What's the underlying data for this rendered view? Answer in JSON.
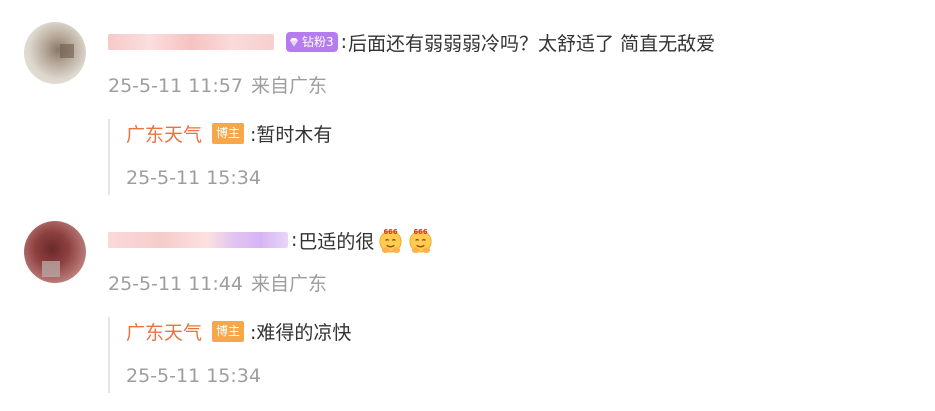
{
  "comments": [
    {
      "fan_badge": "钻粉3",
      "separator": ":",
      "text": "后面还有弱弱弱冷吗？太舒适了 简直无敌爱",
      "timestamp": "25-5-11 11:57",
      "source": "来自广东",
      "reply": {
        "author": "广东天气",
        "badge": "博主",
        "text": ":暂时木有",
        "timestamp": "25-5-11 15:34"
      }
    },
    {
      "separator": ":",
      "text": "巴适的很",
      "emojis": [
        "666-emoji-icon",
        "666-emoji-icon"
      ],
      "timestamp": "25-5-11 11:44",
      "source": "来自广东",
      "reply": {
        "author": "广东天气",
        "badge": "博主",
        "text": ":难得的凉快",
        "timestamp": "25-5-11 15:34"
      }
    }
  ],
  "colors": {
    "author": "#eb7340",
    "author_badge_bg": "#f6a74a",
    "fan_badge_bg": "#b57cf0",
    "meta_text": "#9e9e9e",
    "body_text": "#333333",
    "reply_border": "#e5e5e5"
  }
}
